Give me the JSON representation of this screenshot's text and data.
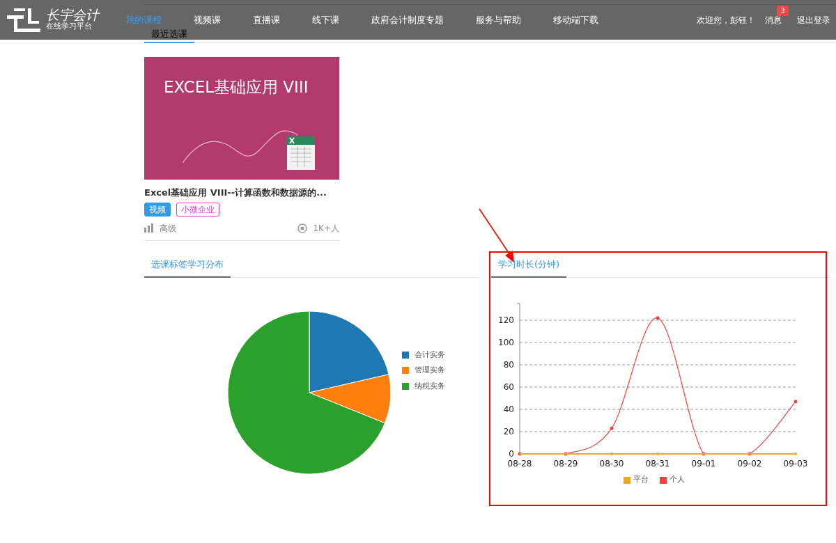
{
  "header": {
    "logo_title": "长宇会计",
    "logo_subtitle": "在线学习平台",
    "nav": [
      {
        "label": "我的课程",
        "selected": true
      },
      {
        "label": "视频课",
        "selected": false
      },
      {
        "label": "直播课",
        "selected": false
      },
      {
        "label": "线下课",
        "selected": false
      },
      {
        "label": "政府会计制度专题",
        "selected": false
      },
      {
        "label": "服务与帮助",
        "selected": false
      },
      {
        "label": "移动端下载",
        "selected": false
      }
    ],
    "welcome": "欢迎您，彭钰！",
    "messages": "消息",
    "message_count": "3",
    "logout": "退出登录"
  },
  "recent_tab": {
    "label": "最近选课",
    "selected": true
  },
  "course": {
    "image_title": "EXCEL基础应用 VIII",
    "title": "Excel基础应用 VIII--计算函数和数据源的...",
    "tags": [
      {
        "label": "视频",
        "kind": "solid"
      },
      {
        "label": "小微企业",
        "kind": "outline"
      }
    ],
    "level": "高级",
    "learners": "1K+人"
  },
  "distribution": {
    "tab": {
      "label": "选课标签学习分布",
      "selected": true
    },
    "legend": [
      {
        "label": "会计实务",
        "color": "#1f77b4"
      },
      {
        "label": "管理实务",
        "color": "#ff7f0e"
      },
      {
        "label": "纳税实务",
        "color": "#2ca02c"
      }
    ]
  },
  "duration": {
    "tab": {
      "label": "学习时长(分钟)",
      "selected": true
    },
    "chart_data": {
      "type": "line",
      "categories": [
        "08-28",
        "08-29",
        "08-30",
        "08-31",
        "09-01",
        "09-02",
        "09-03"
      ],
      "series": [
        {
          "name": "平台",
          "color": "#f5a623",
          "marker": true,
          "values": [
            0,
            0,
            0,
            0,
            0,
            0,
            0
          ]
        },
        {
          "name": "个人",
          "color": "#ef4444",
          "marker": true,
          "values": [
            0,
            0,
            23,
            122,
            0,
            0,
            47
          ]
        }
      ],
      "grid": true,
      "ylim": [
        0,
        135
      ],
      "yticks": [
        0,
        20,
        40,
        60,
        80,
        100,
        120
      ]
    }
  }
}
